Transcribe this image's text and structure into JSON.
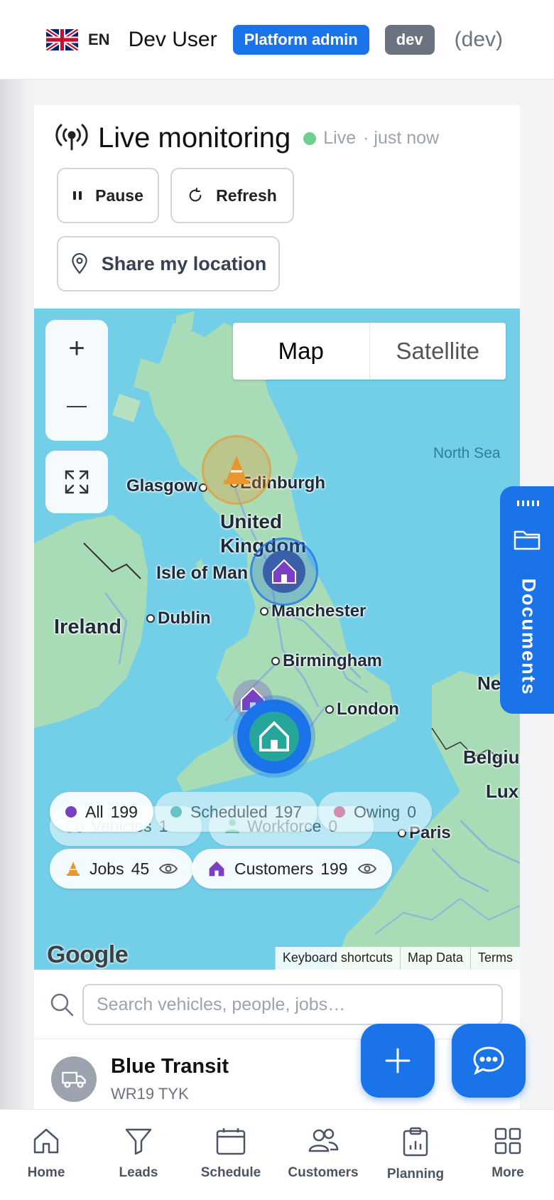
{
  "header": {
    "lang": "EN",
    "user": "Dev User",
    "role_badge": "Platform admin",
    "env_badge": "dev",
    "env_text": "(dev)"
  },
  "monitor": {
    "title": "Live monitoring",
    "status": "Live",
    "updated": "· just now",
    "pause_label": "Pause",
    "refresh_label": "Refresh",
    "share_label": "Share my location"
  },
  "map": {
    "type_map": "Map",
    "type_satellite": "Satellite",
    "zoom_in": "+",
    "zoom_out": "—",
    "places": {
      "glasgow": "Glasgow",
      "edinburgh": "Edinburgh",
      "uk_line1": "United",
      "uk_line2": "Kingdom",
      "isle_of_man": "Isle of Man",
      "dublin": "Dublin",
      "ireland": "Ireland",
      "manchester": "Manchester",
      "birmingham": "Birmingham",
      "london": "London",
      "paris": "Paris",
      "north_sea": "North Sea",
      "neth": "Neth",
      "belgium": "Belgiu",
      "lux": "Lux"
    },
    "filters_row1": [
      {
        "label": "All",
        "count": "199",
        "color": "#7b3fc4"
      },
      {
        "label": "Scheduled",
        "count": "197",
        "color": "#26a69a"
      },
      {
        "label": "Owing",
        "count": "0",
        "color": "#e0487a"
      }
    ],
    "filters_hidden": [
      {
        "label": "Vehicles",
        "count": "1"
      },
      {
        "label": "Workforce",
        "count": "0"
      }
    ],
    "layers": [
      {
        "label": "Jobs",
        "count": "45"
      },
      {
        "label": "Customers",
        "count": "199"
      }
    ],
    "google": "Google",
    "attribution": [
      "Keyboard shortcuts",
      "Map Data",
      "Terms"
    ]
  },
  "search": {
    "placeholder": "Search vehicles, people, jobs…"
  },
  "list": [
    {
      "title": "Blue Transit",
      "subtitle": "WR19 TYK"
    }
  ],
  "documents_tab": "Documents",
  "nav": [
    {
      "label": "Home"
    },
    {
      "label": "Leads"
    },
    {
      "label": "Schedule"
    },
    {
      "label": "Customers"
    },
    {
      "label": "Planning"
    },
    {
      "label": "More"
    }
  ],
  "colors": {
    "accent": "#1a73e8",
    "live": "#6fcf8f",
    "job_marker": "#e8962e",
    "customer_marker": "#7b3fc4",
    "scheduled_marker": "#26a69a"
  }
}
